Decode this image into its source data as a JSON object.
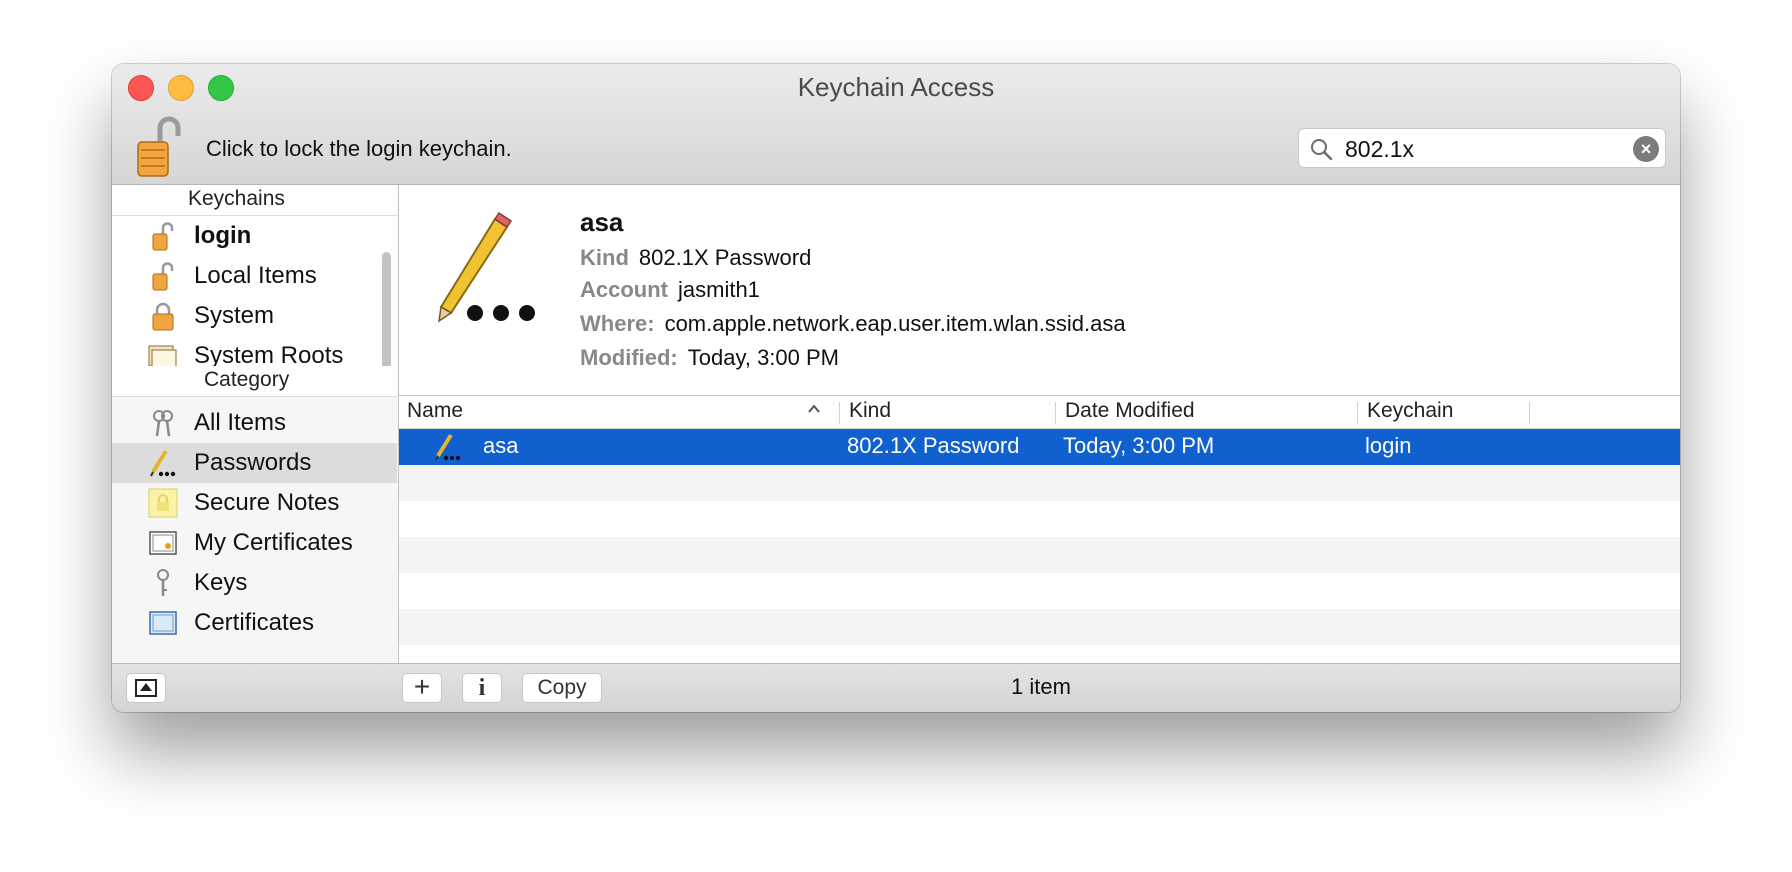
{
  "window": {
    "title": "Keychain Access"
  },
  "toolbar": {
    "lock_label": "Click to lock the login keychain.",
    "search": {
      "value": "802.1x"
    }
  },
  "sidebar": {
    "keychains_header": "Keychains",
    "keychains": [
      {
        "label": "login",
        "icon": "unlocked-lock-icon",
        "bold": true
      },
      {
        "label": "Local Items",
        "icon": "unlocked-lock-icon"
      },
      {
        "label": "System",
        "icon": "locked-lock-icon"
      },
      {
        "label": "System Roots",
        "icon": "certificate-stack-icon"
      }
    ],
    "category_header": "Category",
    "categories": [
      {
        "label": "All Items",
        "icon": "keys-icon"
      },
      {
        "label": "Passwords",
        "icon": "pencil-password-icon",
        "selected": true
      },
      {
        "label": "Secure Notes",
        "icon": "secure-note-icon"
      },
      {
        "label": "My Certificates",
        "icon": "my-certificate-icon"
      },
      {
        "label": "Keys",
        "icon": "key-icon"
      },
      {
        "label": "Certificates",
        "icon": "certificate-icon"
      }
    ]
  },
  "detail": {
    "title": "asa",
    "kind_label": "Kind",
    "kind_value": "802.1X Password",
    "account_label": "Account",
    "account_value": "jasmith1",
    "where_label": "Where:",
    "where_value": "com.apple.network.eap.user.item.wlan.ssid.asa",
    "modified_label": "Modified:",
    "modified_value": "Today, 3:00 PM"
  },
  "table": {
    "columns": [
      "Name",
      "Kind",
      "Date Modified",
      "Keychain"
    ],
    "rows": [
      {
        "name": "asa",
        "kind": "802.1X Password",
        "date_modified": "Today, 3:00 PM",
        "keychain": "login"
      }
    ]
  },
  "bottom": {
    "copy_label": "Copy",
    "add_label": "+",
    "info_label": "i",
    "item_count": "1 item"
  },
  "colors": {
    "selection": "#1060d0",
    "close": "#fc5753",
    "minimize": "#fdbc40",
    "maximize": "#33c748"
  }
}
